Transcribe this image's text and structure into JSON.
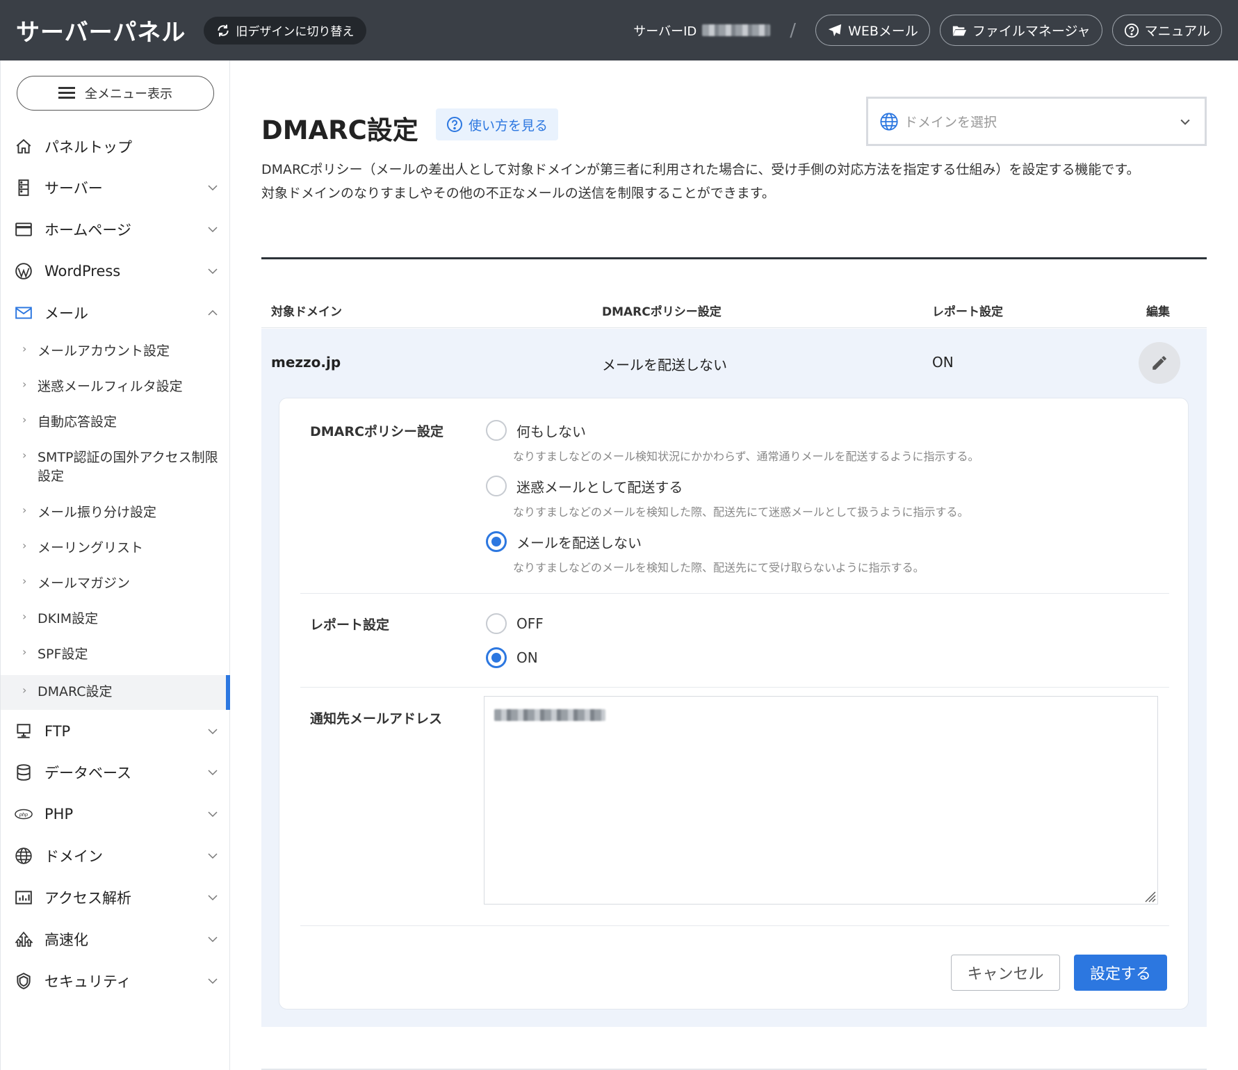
{
  "header": {
    "brand": "サーバーパネル",
    "old_design_label": "旧デザインに切り替え",
    "server_id_label": "サーバーID",
    "slash": "/",
    "webmail_label": "WEBメール",
    "filemanager_label": "ファイルマネージャ",
    "manual_label": "マニュアル"
  },
  "sidebar": {
    "menu_button": "全メニュー表示",
    "items": [
      {
        "label": "パネルトップ",
        "icon": "home-icon"
      },
      {
        "label": "サーバー",
        "icon": "server-icon"
      },
      {
        "label": "ホームページ",
        "icon": "browser-window-icon"
      },
      {
        "label": "WordPress",
        "icon": "wordpress-icon"
      },
      {
        "label": "メール",
        "icon": "mail-icon"
      },
      {
        "label": "FTP",
        "icon": "ftp-icon"
      },
      {
        "label": "データベース",
        "icon": "database-icon"
      },
      {
        "label": "PHP",
        "icon": "php-icon"
      },
      {
        "label": "ドメイン",
        "icon": "globe-icon"
      },
      {
        "label": "アクセス解析",
        "icon": "bar-chart-icon"
      },
      {
        "label": "高速化",
        "icon": "speedup-icon"
      },
      {
        "label": "セキュリティ",
        "icon": "shield-icon"
      }
    ],
    "mail_submenu": [
      "メールアカウント設定",
      "迷惑メールフィルタ設定",
      "自動応答設定",
      "SMTP認証の国外アクセス制限設定",
      "メール振り分け設定",
      "メーリングリスト",
      "メールマガジン",
      "DKIM設定",
      "SPF設定",
      "DMARC設定"
    ],
    "active_item": "DMARC設定"
  },
  "page": {
    "title": "DMARC設定",
    "howto_label": "使い方を見る",
    "domain_select_placeholder": "ドメインを選択",
    "description_line1": "DMARCポリシー（メールの差出人として対象ドメインが第三者に利用された場合に、受け手側の対応方法を指定する仕組み）を設定する機能です。",
    "description_line2": "対象ドメインのなりすましやその他の不正なメールの送信を制限することができます。"
  },
  "table": {
    "headers": [
      "対象ドメイン",
      "DMARCポリシー設定",
      "レポート設定",
      "編集"
    ],
    "row": {
      "domain": "mezzo.jp",
      "policy": "メールを配送しない",
      "report": "ON"
    }
  },
  "form": {
    "policy_label": "DMARCポリシー設定",
    "policy_options": [
      {
        "label": "何もしない",
        "help": "なりすましなどのメール検知状況にかかわらず、通常通りメールを配送するように指示する。",
        "selected": false
      },
      {
        "label": "迷惑メールとして配送する",
        "help": "なりすましなどのメールを検知した際、配送先にて迷惑メールとして扱うように指示する。",
        "selected": false
      },
      {
        "label": "メールを配送しない",
        "help": "なりすましなどのメールを検知した際、配送先にて受け取らないように指示する。",
        "selected": true
      }
    ],
    "report_label": "レポート設定",
    "report_options": [
      {
        "label": "OFF",
        "selected": false
      },
      {
        "label": "ON",
        "selected": true
      }
    ],
    "notify_label": "通知先メールアドレス",
    "cancel_label": "キャンセル",
    "submit_label": "設定する"
  },
  "colors": {
    "header_bg": "#3a3f46",
    "accent": "#2c77e0",
    "row_highlight": "#eef3fb"
  }
}
